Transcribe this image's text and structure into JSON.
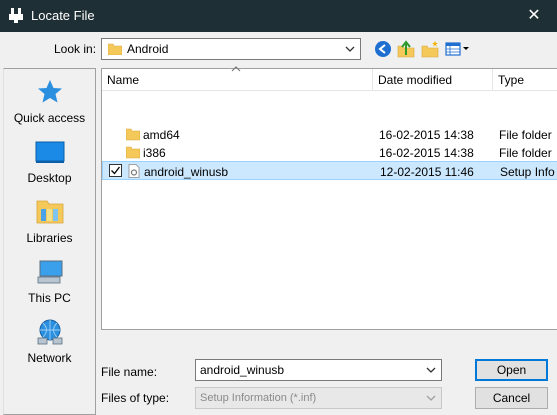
{
  "window": {
    "title": "Locate File",
    "close_glyph": "✕"
  },
  "lookin": {
    "label": "Look in:",
    "value": "Android"
  },
  "toolbar": {
    "icons": [
      "back-icon",
      "up-folder-icon",
      "new-folder-icon",
      "view-menu-icon"
    ]
  },
  "places": [
    {
      "label": "Quick access",
      "icon": "star-icon"
    },
    {
      "label": "Desktop",
      "icon": "desktop-icon"
    },
    {
      "label": "Libraries",
      "icon": "libraries-icon"
    },
    {
      "label": "This PC",
      "icon": "pc-icon"
    },
    {
      "label": "Network",
      "icon": "network-icon"
    }
  ],
  "columns": [
    "Name",
    "Date modified",
    "Type"
  ],
  "files": [
    {
      "name": "amd64",
      "date": "16-02-2015 14:38",
      "type": "File folder",
      "icon": "folder-icon",
      "selected": false
    },
    {
      "name": "i386",
      "date": "16-02-2015 14:38",
      "type": "File folder",
      "icon": "folder-icon",
      "selected": false
    },
    {
      "name": "android_winusb",
      "date": "12-02-2015 11:46",
      "type": "Setup Info",
      "icon": "setup-file-icon",
      "selected": true
    }
  ],
  "bottom": {
    "filename_label": "File name:",
    "filename_value": "android_winusb",
    "filetype_label": "Files of type:",
    "filetype_value": "Setup Information (*.inf)",
    "open_label": "Open",
    "cancel_label": "Cancel"
  },
  "colors": {
    "titlebar": "#1f2f36",
    "selection": "#cce8ff",
    "accent": "#0078d7"
  }
}
